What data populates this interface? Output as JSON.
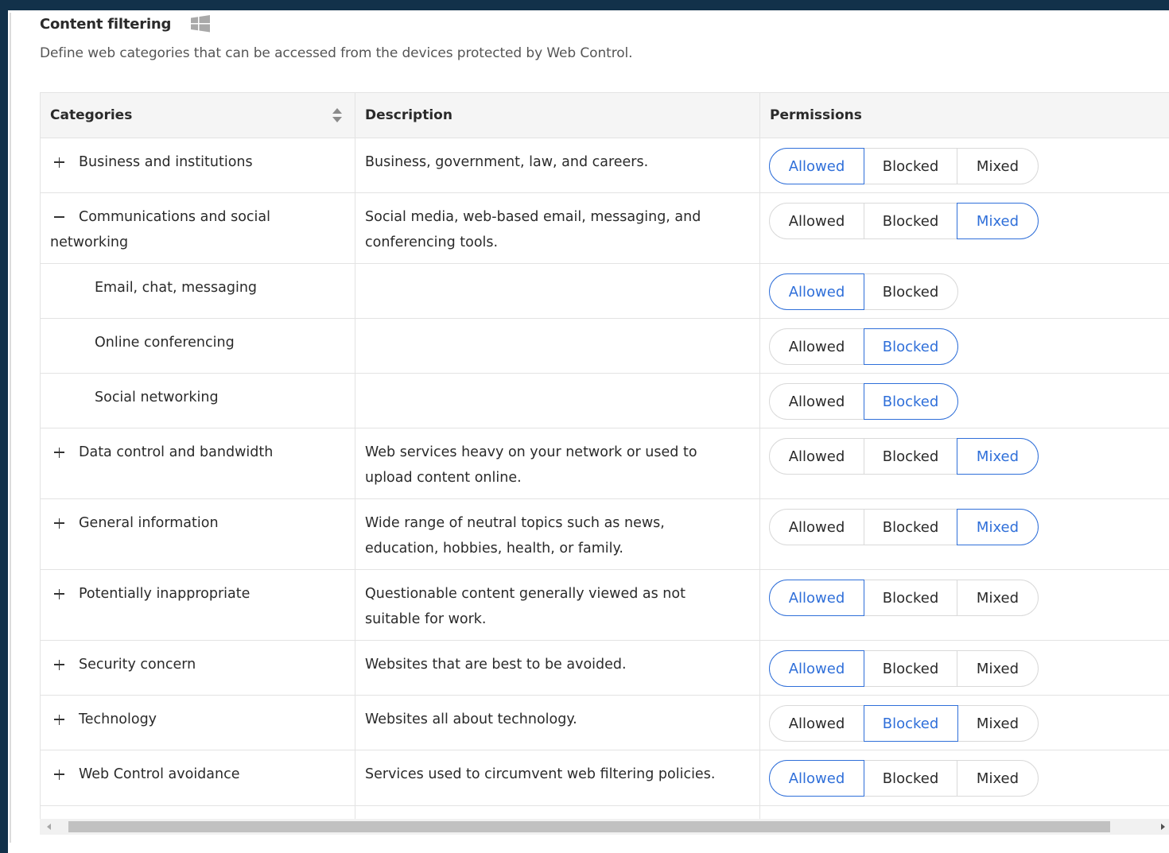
{
  "section": {
    "title": "Content filtering",
    "subtitle": "Define web categories that can be accessed from the devices protected by Web Control."
  },
  "table": {
    "headers": {
      "categories": "Categories",
      "description": "Description",
      "permissions": "Permissions"
    },
    "options": {
      "allowed": "Allowed",
      "blocked": "Blocked",
      "mixed": "Mixed"
    },
    "rows": [
      {
        "category": "Business and institutions",
        "description": "Business, government, law, and careers.",
        "toggle": "plus",
        "permission": "Allowed"
      },
      {
        "category": "Communications and social networking",
        "description": "Social media, web-based email, messaging, and conferencing tools.",
        "toggle": "minus",
        "permission": "Mixed"
      },
      {
        "category": "Email, chat, messaging",
        "description": "",
        "sub": true,
        "permission": "Allowed"
      },
      {
        "category": "Online conferencing",
        "description": "",
        "sub": true,
        "permission": "Blocked"
      },
      {
        "category": "Social networking",
        "description": "",
        "sub": true,
        "permission": "Blocked"
      },
      {
        "category": "Data control and bandwidth",
        "description": "Web services heavy on your network or used to upload content online.",
        "toggle": "plus",
        "permission": "Mixed"
      },
      {
        "category": "General information",
        "description": "Wide range of neutral topics such as news, education, hobbies, health, or family.",
        "toggle": "plus",
        "permission": "Mixed"
      },
      {
        "category": "Potentially inappropriate",
        "description": "Questionable content generally viewed as not suitable for work.",
        "toggle": "plus",
        "permission": "Allowed"
      },
      {
        "category": "Security concern",
        "description": "Websites that are best to be avoided.",
        "toggle": "plus",
        "permission": "Allowed"
      },
      {
        "category": "Technology",
        "description": "Websites all about technology.",
        "toggle": "plus",
        "permission": "Blocked"
      },
      {
        "category": "Web Control avoidance",
        "description": "Services used to circumvent web filtering policies.",
        "toggle": "plus",
        "permission": "Allowed"
      }
    ]
  },
  "colors": {
    "accent": "#2f6fd9",
    "background": "#12314a",
    "header": "#f5f5f5"
  },
  "icons": {
    "platform": "windows-icon",
    "sort": "sort-icon",
    "expand": "plus-icon",
    "collapse": "minus-icon"
  }
}
